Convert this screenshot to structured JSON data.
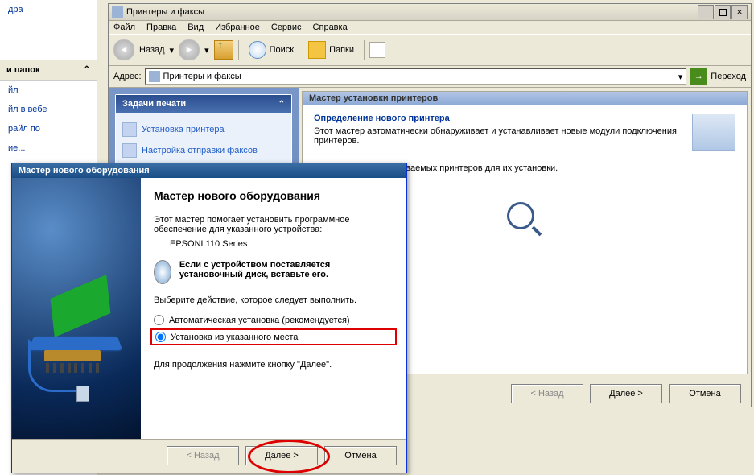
{
  "bg": {
    "section_header": "и папок",
    "items": [
      "дра",
      "йл",
      "йл в вебе",
      "райл по",
      "ие..."
    ]
  },
  "printers_window": {
    "title": "Принтеры и факсы",
    "menu": {
      "file": "Файл",
      "edit": "Правка",
      "view": "Вид",
      "favorites": "Избранное",
      "tools": "Сервис",
      "help": "Справка"
    },
    "toolbar": {
      "back": "Назад",
      "search": "Поиск",
      "folders": "Папки",
      "go": "Переход"
    },
    "address_label": "Адрес:",
    "address_value": "Принтеры и факсы",
    "tasks": {
      "header": "Задачи печати",
      "items": [
        "Установка принтера",
        "Настройка отправки факсов"
      ]
    },
    "wizard": {
      "titlebar": "Мастер установки принтеров",
      "heading": "Определение нового принтера",
      "desc": "Этот мастер автоматически обнаруживает и устанавливает новые модули подключения принтеров.",
      "note_fragment": "ск новых самонастраиваемых принтеров для их установки.",
      "buttons": {
        "back": "< Назад",
        "next": "Далее >",
        "cancel": "Отмена"
      }
    }
  },
  "hw_dialog": {
    "title": "Мастер нового оборудования",
    "heading": "Мастер нового оборудования",
    "intro": "Этот мастер помогает установить программное обеспечение для указанного устройства:",
    "device": "EPSONL110 Series",
    "cd_line": "Если с устройством поставляется установочный диск, вставьте его.",
    "select": "Выберите действие, которое следует выполнить.",
    "opt_auto": "Автоматическая установка (рекомендуется)",
    "opt_manual": "Установка из указанного места",
    "continue": "Для продолжения нажмите кнопку \"Далее\".",
    "buttons": {
      "back": "< Назад",
      "next": "Далее >",
      "cancel": "Отмена"
    }
  }
}
